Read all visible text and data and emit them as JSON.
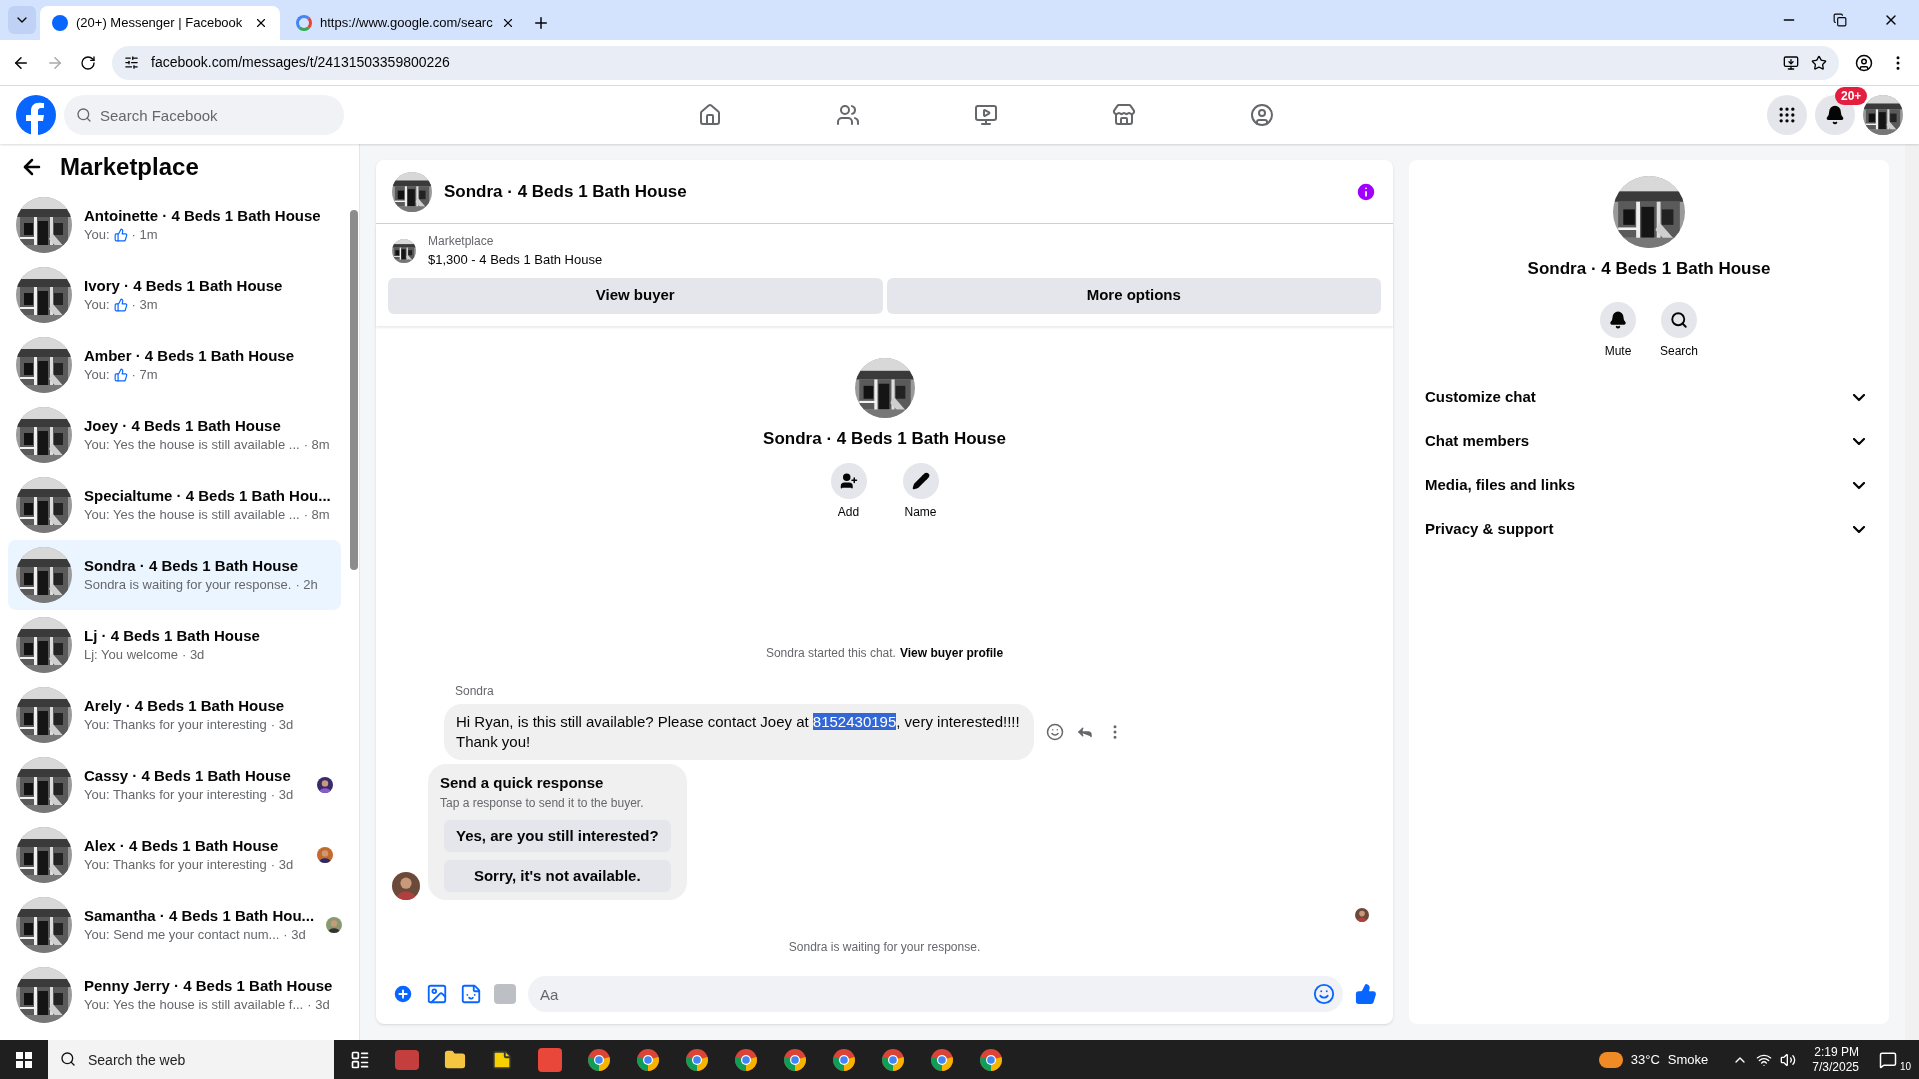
{
  "browser": {
    "tabs": [
      {
        "title": "(20+) Messenger | Facebook",
        "kind": "facebook",
        "selected": true
      },
      {
        "title": "https://www.google.com/searc",
        "kind": "google",
        "selected": false
      }
    ],
    "url": "facebook.com/messages/t/24131503359800226"
  },
  "header": {
    "search": {
      "placeholder": "Search Facebook"
    },
    "nav": [
      {
        "kind": "home"
      },
      {
        "kind": "friends"
      },
      {
        "kind": "video"
      },
      {
        "kind": "marketplace"
      },
      {
        "kind": "groups"
      }
    ],
    "notification_badge": "20+"
  },
  "sidebar": {
    "title": "Marketplace",
    "conversations": [
      {
        "name": "Antoinette · 4 Beds 1 Bath House",
        "preview": "You:",
        "like": true,
        "time": "· 1m",
        "seen": false,
        "selected": false
      },
      {
        "name": "Ivory · 4 Beds 1 Bath House",
        "preview": "You:",
        "like": true,
        "time": "· 3m",
        "seen": false,
        "selected": false
      },
      {
        "name": "Amber · 4 Beds 1 Bath House",
        "preview": "You:",
        "like": true,
        "time": "· 7m",
        "seen": false,
        "selected": false
      },
      {
        "name": "Joey · 4 Beds 1 Bath House",
        "preview": "You: Yes the house is still available ...",
        "like": false,
        "time": "· 8m",
        "seen": false,
        "selected": false
      },
      {
        "name": "Specialtume · 4 Beds 1 Bath Hou...",
        "preview": "You: Yes the house is still available ...",
        "like": false,
        "time": "· 8m",
        "seen": false,
        "selected": false
      },
      {
        "name": "Sondra · 4 Beds 1 Bath House",
        "preview": "Sondra is waiting for your response.",
        "like": false,
        "time": "· 2h",
        "seen": false,
        "selected": true
      },
      {
        "name": "Lj · 4 Beds 1 Bath House",
        "preview": "Lj: You welcome",
        "like": false,
        "time": "· 3d",
        "seen": false,
        "selected": false
      },
      {
        "name": "Arely · 4 Beds 1 Bath House",
        "preview": "You: Thanks for your interesting",
        "like": false,
        "time": "· 3d",
        "seen": false,
        "selected": false
      },
      {
        "name": "Cassy · 4 Beds 1 Bath House",
        "preview": "You: Thanks for your interesting",
        "like": false,
        "time": "· 3d",
        "seen": true,
        "selected": false
      },
      {
        "name": "Alex · 4 Beds 1 Bath House",
        "preview": "You: Thanks for your interesting",
        "like": false,
        "time": "· 3d",
        "seen": true,
        "selected": false
      },
      {
        "name": "Samantha · 4 Beds 1 Bath Hou...",
        "preview": "You: Send me your contact num...",
        "like": false,
        "time": "· 3d",
        "seen": true,
        "selected": false
      },
      {
        "name": "Penny Jerry · 4 Beds 1 Bath House",
        "preview": "You: Yes the house is still available f...",
        "like": false,
        "time": "· 3d",
        "seen": false,
        "selected": false
      }
    ]
  },
  "chat": {
    "title": "Sondra · 4 Beds 1 Bath House",
    "listing": {
      "label": "Marketplace",
      "title": "$1,300 - 4 Beds 1 Bath House"
    },
    "buttons": [
      "View buyer",
      "More options"
    ],
    "intro": {
      "name": "Sondra · 4 Beds 1 Bath House",
      "actions": [
        {
          "kind": "add",
          "label": "Add"
        },
        {
          "kind": "name",
          "label": "Name"
        }
      ]
    },
    "started": {
      "text": "Sondra started this chat.",
      "link": "View buyer profile"
    },
    "message": {
      "sender": "Sondra",
      "parts": [
        {
          "text": "Hi Ryan, is this still available? Please contact Joey at  ",
          "selected": false
        },
        {
          "text": "8152430195",
          "selected": true
        },
        {
          "text": ", very interested!!!! Thank you!",
          "selected": false
        }
      ]
    },
    "quick_response": {
      "title": "Send a quick response",
      "hint": "Tap a response to send it to the buyer.",
      "options": [
        "Yes, are you still interested?",
        "Sorry, it's not available."
      ]
    },
    "status": "Sondra is waiting for your response.",
    "composer": {
      "placeholder": "Aa"
    }
  },
  "details": {
    "name": "Sondra · 4 Beds 1 Bath House",
    "actions": [
      {
        "kind": "mute",
        "label": "Mute"
      },
      {
        "kind": "search",
        "label": "Search"
      }
    ],
    "sections": [
      {
        "label": "Customize chat",
        "expanded": false
      },
      {
        "label": "Chat members",
        "expanded": false
      },
      {
        "label": "Media, files and links",
        "expanded": false
      },
      {
        "label": "Privacy & support",
        "expanded": false
      }
    ]
  },
  "taskbar": {
    "search": {
      "placeholder": "Search the web"
    },
    "weather": {
      "temperature": "33°C",
      "condition": "Smoke"
    },
    "time": "2:19 PM",
    "date": "7/3/2025",
    "notifications": "10"
  }
}
